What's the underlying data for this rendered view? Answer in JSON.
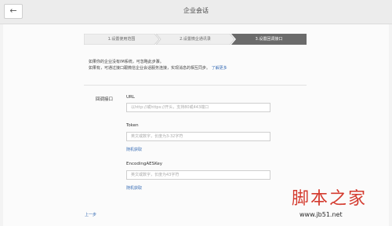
{
  "header": {
    "back_icon": "←",
    "title": "企业会话"
  },
  "steps": [
    {
      "label": "1.设置使用范围",
      "active": false
    },
    {
      "label": "2.设置微企通讯录",
      "active": false
    },
    {
      "label": "3.设置回调接口",
      "active": true
    }
  ],
  "description": {
    "line1": "如果你的企业没有IM系统，可忽略此步骤。",
    "line2": "如果有，可通过接口跟微信企业会话服务连接，实现消息的相互同步。",
    "learn_more": "了解更多"
  },
  "form": {
    "section_label": "回调接口",
    "url": {
      "label": "URL",
      "placeholder": "以http://或https://开头，支持80或443端口"
    },
    "token": {
      "label": "Token",
      "placeholder": "英文或数字，长度为3-32字符",
      "random_link": "随机获取"
    },
    "aes": {
      "label": "EncodingAESKey",
      "placeholder": "英文或数字，长度为43字符",
      "random_link": "随机获取"
    }
  },
  "footer": {
    "prev_link": "上一步"
  },
  "watermark": {
    "title": "脚本之家",
    "url": "www.jb51.net"
  },
  "colors": {
    "active_step": "#6b6b6b",
    "inactive_step": "#eeeeee",
    "link": "#3b6fb6",
    "watermark": "#d43b2f"
  }
}
